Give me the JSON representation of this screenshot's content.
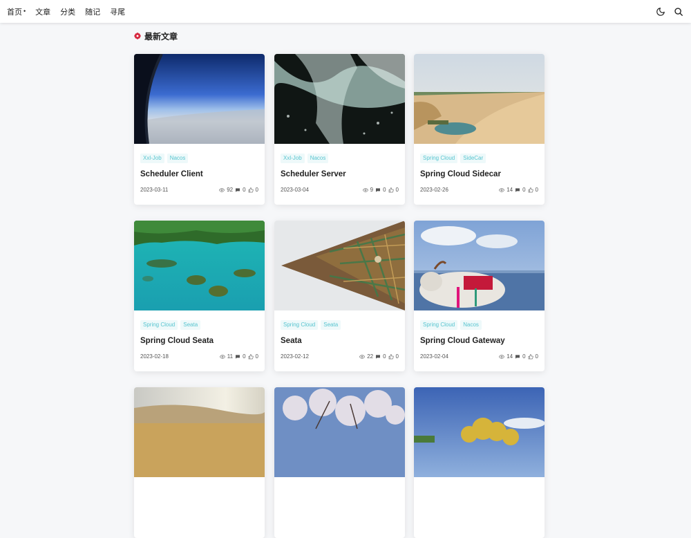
{
  "nav": {
    "items": [
      {
        "label": "首页",
        "has_dropdown": true
      },
      {
        "label": "文章"
      },
      {
        "label": "分类"
      },
      {
        "label": "随记"
      },
      {
        "label": "寻尾"
      }
    ],
    "dropdown_marker": "•"
  },
  "section": {
    "title": "最新文章"
  },
  "articles": [
    {
      "tags": [
        "Xxl-Job",
        "Nacos"
      ],
      "title": "Scheduler Client",
      "date": "2023-03-11",
      "views": "92",
      "comments": "0",
      "likes": "0"
    },
    {
      "tags": [
        "Xxl-Job",
        "Nacos"
      ],
      "title": "Scheduler Server",
      "date": "2023-03-04",
      "views": "9",
      "comments": "0",
      "likes": "0"
    },
    {
      "tags": [
        "Spring Cloud",
        "SideCar"
      ],
      "title": "Spring Cloud Sidecar",
      "date": "2023-02-26",
      "views": "14",
      "comments": "0",
      "likes": "0"
    },
    {
      "tags": [
        "Spring Cloud",
        "Seata"
      ],
      "title": "Spring Cloud Seata",
      "date": "2023-02-18",
      "views": "11",
      "comments": "0",
      "likes": "0"
    },
    {
      "tags": [
        "Spring Cloud",
        "Seata"
      ],
      "title": "Seata",
      "date": "2023-02-12",
      "views": "22",
      "comments": "0",
      "likes": "0"
    },
    {
      "tags": [
        "Spring Cloud",
        "Nacos"
      ],
      "title": "Spring Cloud Gateway",
      "date": "2023-02-04",
      "views": "14",
      "comments": "0",
      "likes": "0"
    }
  ],
  "icons": {
    "theme_toggle": "moon-icon",
    "search": "search-icon",
    "section": "flower-icon",
    "views": "eye-icon",
    "comments": "comment-icon",
    "likes": "thumb-up-icon"
  },
  "colors": {
    "tag_text": "#56c4cf",
    "tag_bg": "#eef9fa",
    "section_icon": "#d6243c",
    "page_bg": "#f6f7f9"
  }
}
